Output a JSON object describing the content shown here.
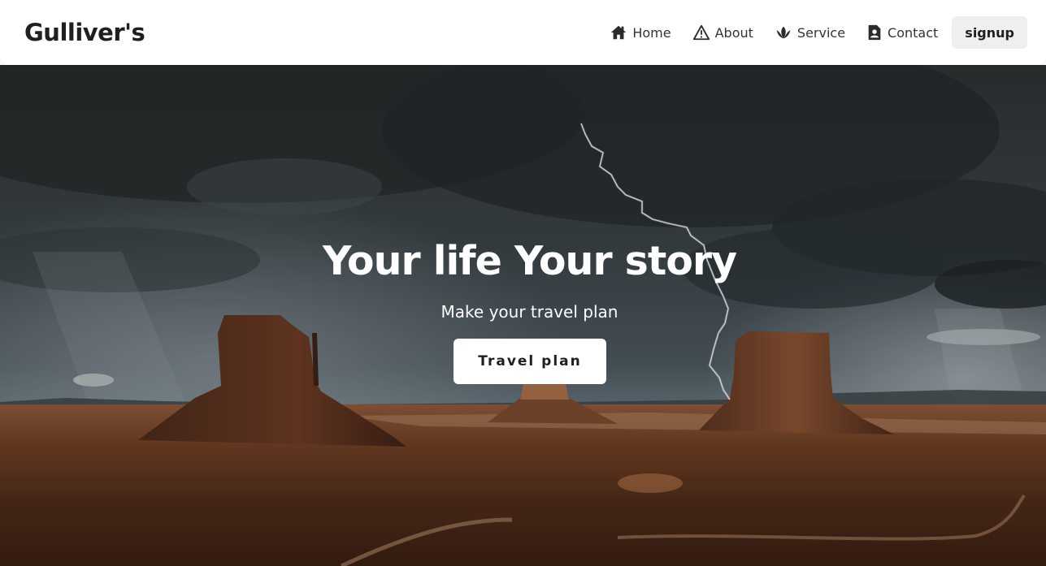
{
  "header": {
    "brand": "Gulliver's",
    "nav": [
      {
        "label": "Home",
        "icon": "home-icon"
      },
      {
        "label": "About",
        "icon": "warning-triangle-icon"
      },
      {
        "label": "Service",
        "icon": "leaf-icon"
      },
      {
        "label": "Contact",
        "icon": "contact-card-icon"
      }
    ],
    "signup_label": "signup"
  },
  "hero": {
    "title": "Your life Your story",
    "subtitle": "Make your travel plan",
    "cta_label": "Travel plan"
  },
  "colors": {
    "header_bg": "#ffffff",
    "brand_text": "#1f1f1f",
    "nav_text": "#333333",
    "signup_bg": "#efefef",
    "hero_text": "#ffffff",
    "cta_bg": "#ffffff"
  }
}
